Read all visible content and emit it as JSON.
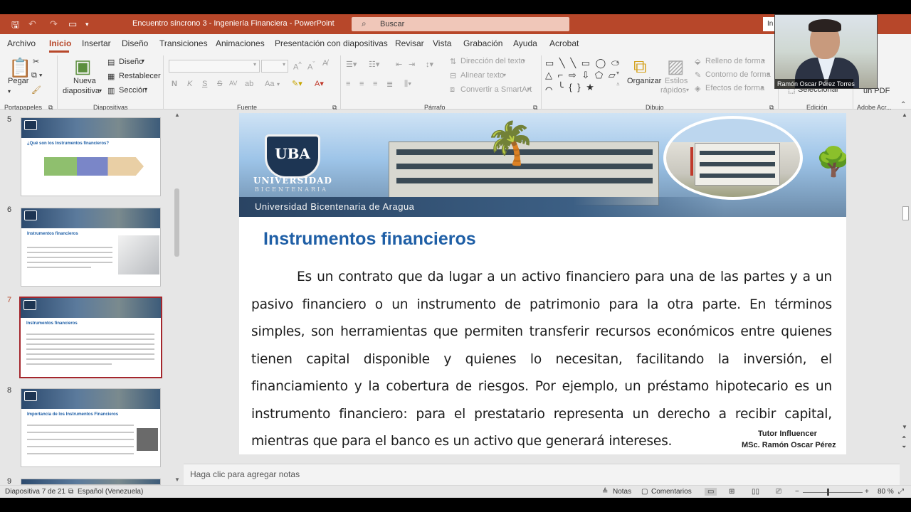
{
  "window": {
    "title": "Encuentro síncrono 3 - Ingeniería Financiera  -  PowerPoint",
    "search_placeholder": "Buscar",
    "right_btn": "In"
  },
  "menu": [
    "Archivo",
    "Inicio",
    "Insertar",
    "Diseño",
    "Transiciones",
    "Animaciones",
    "Presentación con diapositivas",
    "Revisar",
    "Vista",
    "Grabación",
    "Ayuda",
    "Acrobat"
  ],
  "ribbon": {
    "portapapeles": {
      "label": "Portapapeles",
      "pegar": "Pegar"
    },
    "diapositivas": {
      "label": "Diapositivas",
      "nueva": "Nueva",
      "diapositiva": "diapositiva",
      "diseno": "Diseño",
      "restablecer": "Restablecer",
      "seccion": "Sección"
    },
    "fuente": {
      "label": "Fuente",
      "bold": "N",
      "italic": "K",
      "underline": "S",
      "strike": "S",
      "spacing": "AV",
      "case": "Aa"
    },
    "parrafo": {
      "label": "Párrafo",
      "direccion": "Dirección del texto",
      "alinear": "Alinear texto",
      "convertir": "Convertir a SmartArt"
    },
    "dibujo": {
      "label": "Dibujo",
      "organizar": "Organizar",
      "estilos1": "Estilos",
      "estilos2": "rápidos",
      "relleno": "Relleno de forma",
      "contorno": "Contorno de forma",
      "efectos": "Efectos de forma",
      "shapes": "▭ ╲ ╲ ▭ ◯ ⬭ △ ⌐ ⇨ ⇩ ⬠ ▱ ⌒ ╰ { } ★"
    },
    "edicion": {
      "label": "Edición",
      "seleccionar": "Seleccionar"
    },
    "adobe": {
      "label": "Adobe Acr...",
      "pdf": "un PDF"
    }
  },
  "thumbnails": [
    {
      "num": "5",
      "title": "¿Qué son los Instrumentos financieros?"
    },
    {
      "num": "6",
      "title": "Instrumentos financieros"
    },
    {
      "num": "7",
      "title": "Instrumentos financieros"
    },
    {
      "num": "8",
      "title": "Importancia de los Instrumentos Financieros"
    },
    {
      "num": "9",
      "title": ""
    }
  ],
  "slide": {
    "university_logo": "UBA",
    "university_word": "UNIVERSIDAD",
    "university_sub": "BICENTENARIA",
    "university_full": "Universidad Bicentenaria de Aragua",
    "title": "Instrumentos financieros",
    "body": "Es un contrato que da lugar a un activo financiero para una de las partes y a un pasivo financiero o un instrumento de patrimonio para la otra parte. En términos simples, son herramientas que permiten transferir recursos económicos entre quienes tienen capital disponible y quienes lo necesitan, facilitando la inversión, el financiamiento y la cobertura de riesgos. Por ejemplo, un préstamo hipotecario es un instrumento financiero: para el prestatario representa un derecho a recibir capital, mientras que para el banco es un activo que generará intereses.",
    "tutor": "Tutor Influencer",
    "msc": "MSc. Ramón Oscar Pérez"
  },
  "notes_placeholder": "Haga clic para agregar notas",
  "status": {
    "slide": "Diapositiva 7 de 21",
    "language": "Español (Venezuela)",
    "notas": "Notas",
    "comentarios": "Comentarios",
    "zoom": "80 %"
  },
  "webcam": {
    "name": "Ramón Oscar Pérez Torres"
  },
  "colors": {
    "accent": "#b7472a",
    "title_blue": "#1f5fa6",
    "selected_border": "#a4262c"
  }
}
